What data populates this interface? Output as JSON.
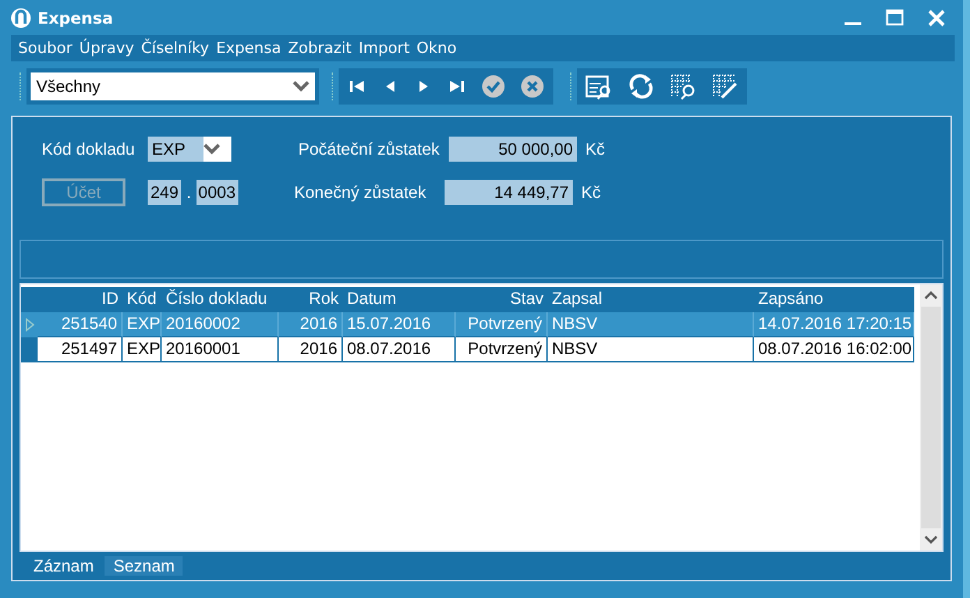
{
  "window": {
    "title": "Expensa"
  },
  "menu": [
    "Soubor",
    "Úpravy",
    "Číselníky",
    "Expensa",
    "Zobrazit",
    "Import",
    "Okno"
  ],
  "filter": {
    "value": "Všechny"
  },
  "nav_buttons": [
    {
      "kind": "first",
      "disabled": false
    },
    {
      "kind": "prev",
      "disabled": false
    },
    {
      "kind": "next",
      "disabled": false
    },
    {
      "kind": "last",
      "disabled": false
    },
    {
      "kind": "confirm",
      "disabled": true
    },
    {
      "kind": "cancel",
      "disabled": true
    }
  ],
  "tool_buttons": [
    {
      "kind": "form-search"
    },
    {
      "kind": "refresh"
    },
    {
      "kind": "grid-search"
    },
    {
      "kind": "grid-edit"
    }
  ],
  "form": {
    "code_label": "Kód dokladu",
    "code_value": "EXP",
    "account_button": {
      "label": "Účet",
      "disabled": true
    },
    "account_a": "249",
    "account_sep": ".",
    "account_b": "0003",
    "start_label": "Počáteční zůstatek",
    "start_value": "50 000,00",
    "end_label": "Konečný zůstatek",
    "end_value": "14 449,77",
    "currency_start": "Kč",
    "currency_end": "Kč"
  },
  "table": {
    "columns": [
      {
        "label": "ID"
      },
      {
        "label": "Kód"
      },
      {
        "label": "Číslo dokladu"
      },
      {
        "label": "Rok"
      },
      {
        "label": "Datum"
      },
      {
        "label": "Stav"
      },
      {
        "label": "Zapsal"
      },
      {
        "label": "Zapsáno"
      }
    ],
    "rows": [
      {
        "selected": true,
        "cells": [
          "251540",
          "EXP",
          "20160002",
          "2016",
          "15.07.2016",
          "Potvrzený",
          "NBSV",
          "14.07.2016 17:20:15"
        ]
      },
      {
        "selected": false,
        "cells": [
          "251497",
          "EXP",
          "20160001",
          "2016",
          "08.07.2016",
          "Potvrzený",
          "NBSV",
          "08.07.2016 16:02:00"
        ]
      }
    ]
  },
  "tabs": [
    {
      "label": "Záznam",
      "selected": false
    },
    {
      "label": "Seznam",
      "selected": true
    }
  ]
}
